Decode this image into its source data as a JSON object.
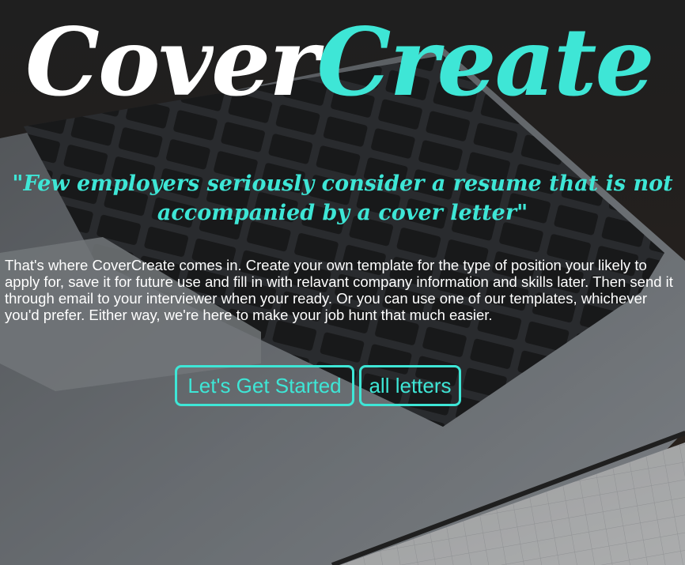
{
  "brand": {
    "part1": "Cover",
    "part2": "Create"
  },
  "hero": {
    "quote": "\"Few employers seriously consider a resume that is not accompanied by a cover letter\"",
    "intro": "That's where CoverCreate comes in. Create your own template for the type of position your likely to apply for, save it for future use and fill in with relavant company information and skills later. Then send it through email to your interviewer when your ready. Or you can use one of our templates, whichever you'd prefer. Either way, we're here to make your job hunt that much easier."
  },
  "actions": {
    "get_started_label": "Let's Get Started",
    "all_letters_label": "all letters"
  },
  "colors": {
    "accent": "#3ee6d6",
    "text": "#ffffff",
    "background": "#2a2a2a"
  },
  "background_image": "laptop-keyboard-photo"
}
